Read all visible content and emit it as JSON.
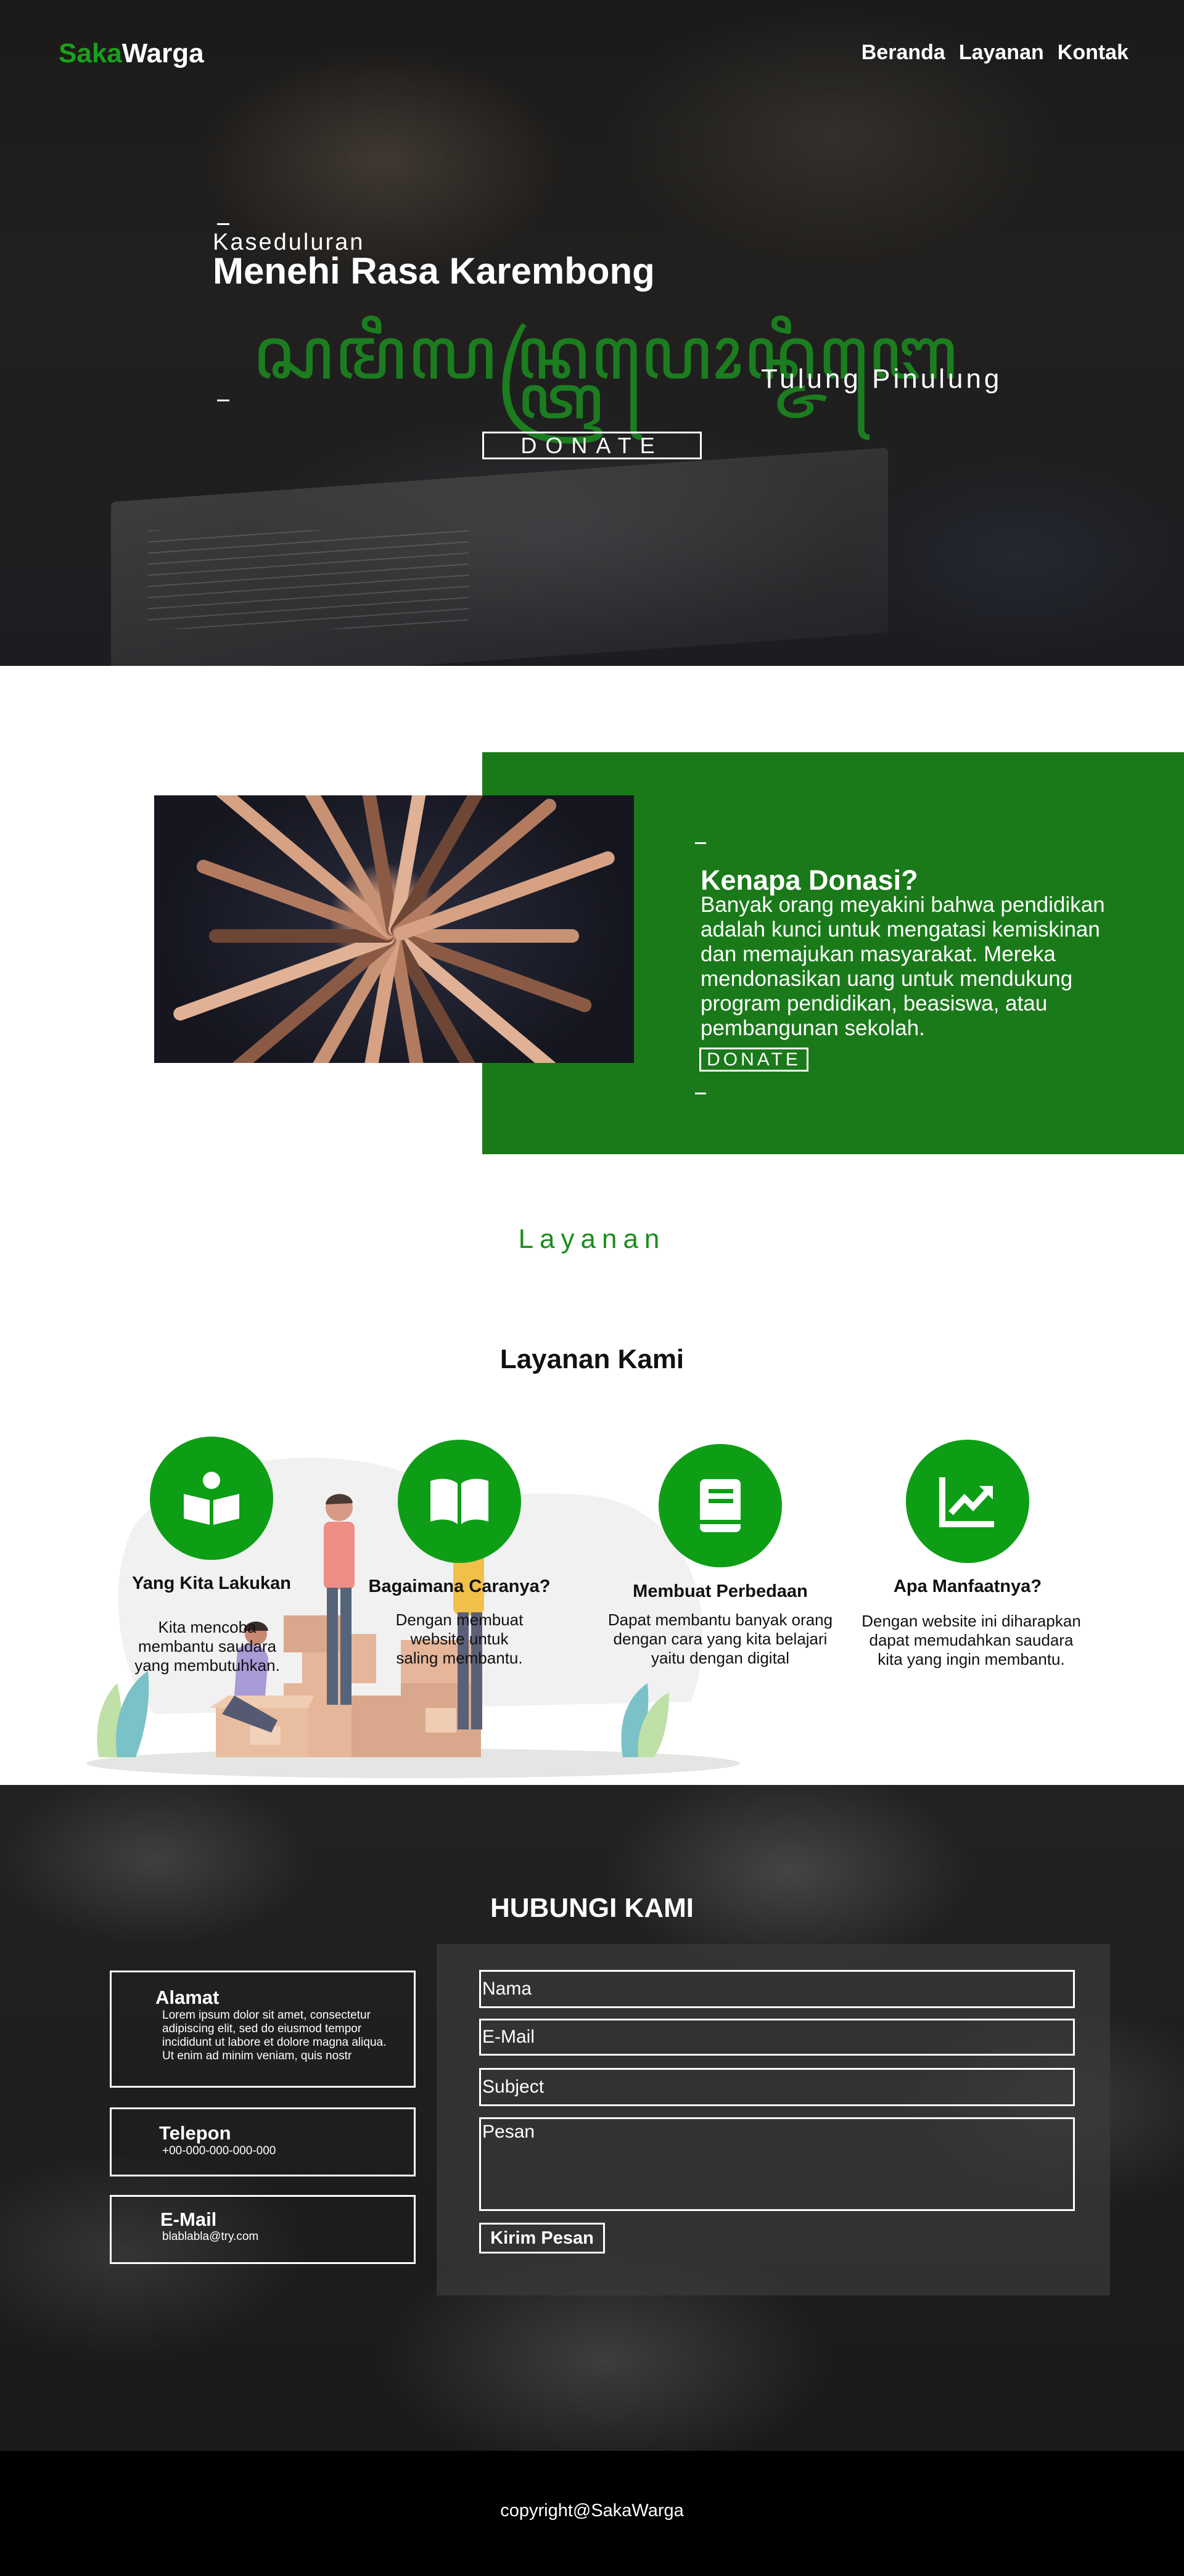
{
  "brand": {
    "part1": "Saka",
    "part2": "Warga",
    "accent_color": "#19a11c"
  },
  "nav": {
    "items": [
      "Beranda",
      "Layanan",
      "Kontak"
    ]
  },
  "hero": {
    "kicker": "Kaseduluran",
    "title": "Menehi Rasa Karembong",
    "script": "ꦱꦩꦶꦭꦤ꧀ꦠꦿꦥꦺꦴꦤ꧀ꦗꦶꦧꦺ",
    "subtitle": "Tulung Pinulung",
    "donate_label": "DONATE"
  },
  "why": {
    "title": "Kenapa Donasi?",
    "body": "Banyak orang meyakini bahwa pendidikan adalah kunci untuk mengatasi kemiskinan dan memajukan masyarakat. Mereka mendonasikan uang untuk mendukung program pendidikan, beasiswa, atau pembangunan sekolah.",
    "donate_label": "DONATE",
    "panel_color": "#1a7a1a"
  },
  "services": {
    "label": "Layanan",
    "title": "Layanan Kami",
    "icon_color": "#0e9e16",
    "items": [
      {
        "icon": "book-reader-icon",
        "name": "Yang Kita Lakukan",
        "desc": "Kita mencoba membantu saudara yang membutuhkan."
      },
      {
        "icon": "open-book-icon",
        "name": "Bagaimana Caranya?",
        "desc": "Dengan membuat website untuk saling membantu."
      },
      {
        "icon": "notebook-icon",
        "name": "Membuat Perbedaan",
        "desc": "Dapat membantu banyak orang dengan cara yang kita belajari yaitu dengan digital"
      },
      {
        "icon": "chart-up-icon",
        "name": "Apa Manfaatnya?",
        "desc": "Dengan website ini diharapkan dapat memudahkan saudara kita yang ingin membantu."
      }
    ]
  },
  "contact": {
    "title": "HUBUNGI KAMI",
    "address_title": "Alamat",
    "address_text": "Lorem ipsum dolor sit amet, consectetur adipiscing elit, sed do eiusmod tempor incididunt ut labore et dolore magna aliqua. Ut enim ad minim veniam, quis nostr",
    "phone_title": "Telepon",
    "phone_value": "+00-000-000-000-000",
    "email_title": "E-Mail",
    "email_value": "blablabla@try.com",
    "form": {
      "name_placeholder": "Nama",
      "email_placeholder": "E-Mail",
      "subject_placeholder": "Subject",
      "message_placeholder": "Pesan",
      "submit_label": "Kirim Pesan"
    }
  },
  "footer": {
    "copyright": "copyright@SakaWarga"
  }
}
